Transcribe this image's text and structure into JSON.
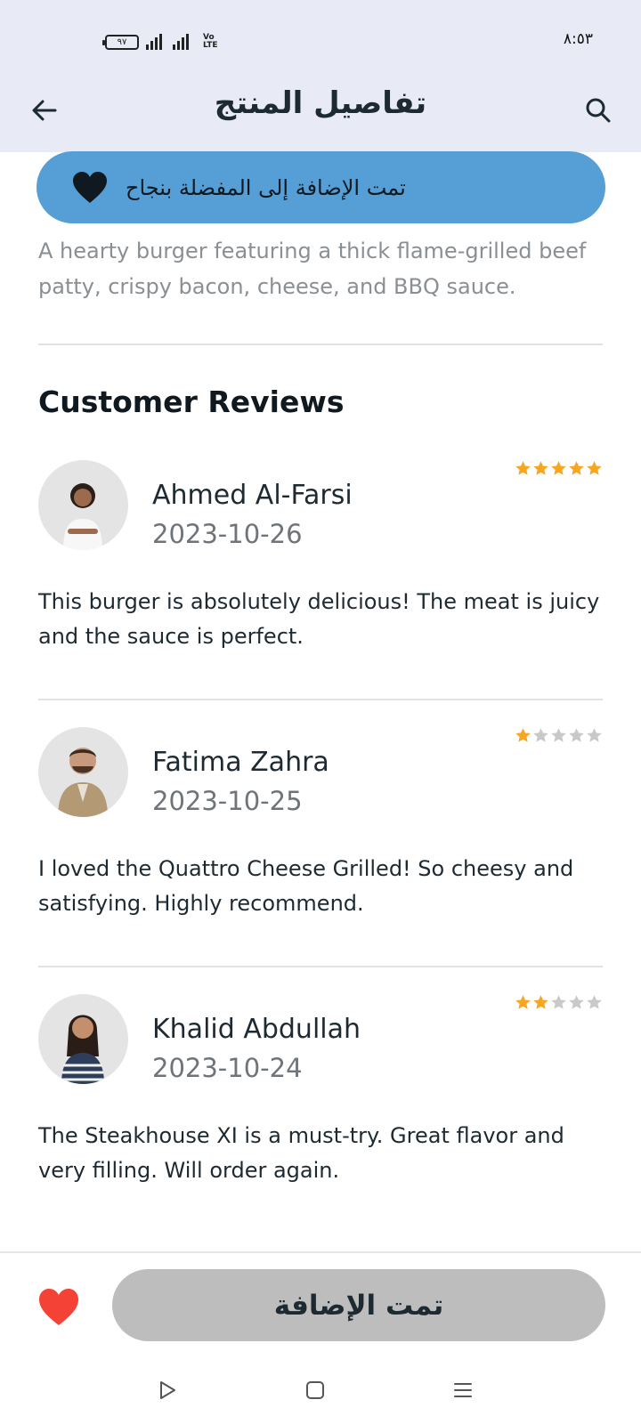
{
  "status_bar": {
    "time": "٨:٥٣",
    "battery": "٩٧",
    "network_label": "Vo LTE"
  },
  "app_bar": {
    "title": "تفاصيل المنتج",
    "back_icon": "arrow-left-icon",
    "search_icon": "search-icon"
  },
  "toast": {
    "message": "تمت الإضافة إلى المفضلة بنجاح",
    "icon": "heart-icon",
    "background": "#559fd6"
  },
  "product": {
    "description": "A hearty burger featuring a thick flame-grilled beef patty, crispy bacon, cheese, and BBQ sauce."
  },
  "reviews_section": {
    "title": "Customer Reviews",
    "reviews": [
      {
        "name": "Ahmed Al-Farsi",
        "date": "2023-10-26",
        "rating": 5,
        "text": "This burger is absolutely delicious! The meat is juicy and the sauce is perfect."
      },
      {
        "name": "Fatima Zahra",
        "date": "2023-10-25",
        "rating": 1,
        "text": "I loved the Quattro Cheese Grilled! So cheesy and satisfying. Highly recommend."
      },
      {
        "name": "Khalid Abdullah",
        "date": "2023-10-24",
        "rating": 2,
        "text": "The Steakhouse XI is a must-try. Great flavor and very filling. Will order again."
      }
    ]
  },
  "bottom_bar": {
    "favorite_icon": "heart-icon",
    "favorite_color": "#f44336",
    "button_label": "تمت الإضافة"
  },
  "colors": {
    "star_filled": "#f5a623",
    "star_empty": "#c9c9c9"
  },
  "nav_bar": {
    "back_icon": "triangle-play-icon",
    "home_icon": "square-icon",
    "menu_icon": "menu-icon"
  }
}
